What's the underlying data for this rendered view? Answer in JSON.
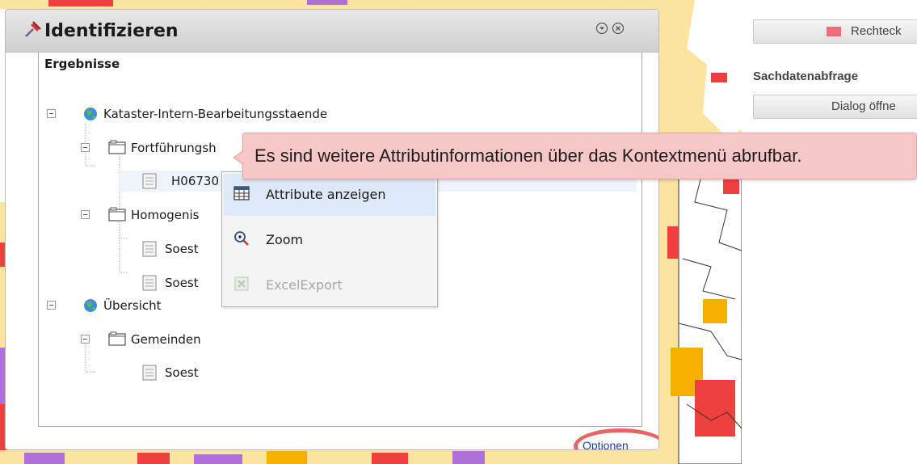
{
  "window": {
    "title": "Identifizieren",
    "icons": {
      "pin": "pin-icon",
      "collapse": "collapse-icon",
      "close": "close-icon"
    }
  },
  "results": {
    "heading": "Ergebnisse",
    "tree": [
      {
        "label": "Kataster-Intern-Bearbeitungsstaende",
        "type": "service",
        "icon": "globe-icon"
      },
      {
        "label": "Fortführungsh",
        "type": "layer",
        "icon": "folder-icon"
      },
      {
        "label": "H06730",
        "type": "feature",
        "icon": "document-icon",
        "selected": true
      },
      {
        "label": "Homogenis",
        "type": "layer",
        "icon": "folder-icon"
      },
      {
        "label": "Soest",
        "type": "feature",
        "icon": "document-icon"
      },
      {
        "label": "Soest",
        "type": "feature",
        "icon": "document-icon"
      },
      {
        "label": "Übersicht",
        "type": "service",
        "icon": "globe-icon"
      },
      {
        "label": "Gemeinden",
        "type": "layer",
        "icon": "folder-icon"
      },
      {
        "label": "Soest",
        "type": "feature",
        "icon": "document-icon"
      }
    ]
  },
  "tooltip": {
    "text": "Es sind weitere Attributinformationen über das Kontextmenü abrufbar."
  },
  "context_menu": {
    "items": [
      {
        "label": "Attribute anzeigen",
        "icon": "table-icon",
        "enabled": true,
        "highlighted": true
      },
      {
        "label": "Zoom",
        "icon": "magnifier-icon",
        "enabled": true
      },
      {
        "label": "ExcelExport",
        "icon": "excel-icon",
        "enabled": false
      }
    ]
  },
  "options_link": "Optionen",
  "right_panel": {
    "rect_button": "Rechteck",
    "section_label": "Sachdatenabfrage",
    "dialog_button": "Dialog öffne"
  },
  "colors": {
    "tooltip_bg": "#f7c6c6",
    "highlight_ring": "#e24b4b",
    "link": "#1f3fb0",
    "map_yellow": "#fbe4a0",
    "map_red": "#ef4040",
    "map_orange": "#f5b000",
    "map_purple": "#b070d8"
  }
}
